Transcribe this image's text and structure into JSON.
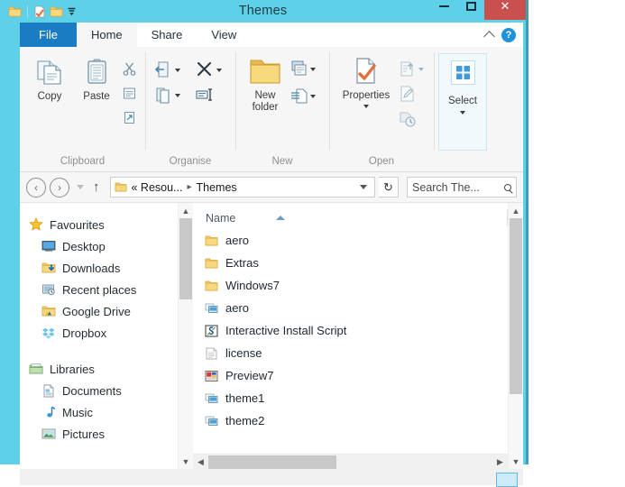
{
  "window": {
    "title": "Themes",
    "controls": {
      "minimize": "minimize-button",
      "maximize": "maximize-button",
      "close": "✕"
    }
  },
  "quick_access": {
    "items": [
      "folder-icon",
      "properties-icon",
      "new-folder-icon",
      "customize-caret"
    ]
  },
  "ribbon": {
    "tabs": [
      {
        "label": "File",
        "active": false,
        "style": "file"
      },
      {
        "label": "Home",
        "active": true
      },
      {
        "label": "Share",
        "active": false
      },
      {
        "label": "View",
        "active": false
      }
    ],
    "collapse_icon": "chevron-up-icon",
    "help_icon": "?",
    "groups": [
      {
        "label": "Clipboard",
        "big_buttons": [
          {
            "label": "Copy",
            "icon": "copy-icon"
          },
          {
            "label": "Paste",
            "icon": "paste-icon"
          }
        ],
        "small_buttons": [
          {
            "name": "cut",
            "icon": "scissors-icon"
          },
          {
            "name": "copy-path",
            "icon": "copy-path-icon"
          },
          {
            "name": "paste-shortcut",
            "icon": "paste-shortcut-icon"
          }
        ]
      },
      {
        "label": "Organise",
        "small_buttons": [
          {
            "name": "move-to",
            "icon": "move-to-icon",
            "caret": true
          },
          {
            "name": "delete",
            "icon": "delete-x-icon",
            "caret": true
          },
          {
            "name": "copy-to",
            "icon": "copy-to-icon",
            "caret": true
          },
          {
            "name": "rename",
            "icon": "rename-icon",
            "caret": false
          }
        ]
      },
      {
        "label": "New",
        "big_buttons": [
          {
            "label": "New\nfolder",
            "line1": "New",
            "line2": "folder",
            "icon": "new-folder-icon"
          }
        ],
        "small_buttons": [
          {
            "name": "new-item",
            "icon": "new-item-icon",
            "caret": true
          },
          {
            "name": "easy-access",
            "icon": "easy-access-icon",
            "caret": true
          }
        ]
      },
      {
        "label": "Open",
        "big_buttons": [
          {
            "label": "Properties",
            "icon": "properties-icon",
            "caret": true
          }
        ],
        "small_buttons": [
          {
            "name": "open",
            "icon": "open-icon",
            "caret": true
          },
          {
            "name": "edit",
            "icon": "edit-icon",
            "caret": false
          },
          {
            "name": "history",
            "icon": "history-icon",
            "caret": false
          }
        ]
      },
      {
        "label": "Select",
        "is_select": true,
        "button": {
          "label": "Select",
          "icon": "select-grid-icon"
        }
      }
    ]
  },
  "address_bar": {
    "back": "‹",
    "forward": "›",
    "recent_caret": "history-dropdown",
    "up": "↑",
    "folder_icon": "folder-icon",
    "crumbs": [
      "« Resou...",
      "Themes"
    ],
    "separator": "▸",
    "dropdown": "address-dropdown",
    "refresh": "↻",
    "search_placeholder": "Search The...",
    "search_value": ""
  },
  "nav_pane": {
    "sections": [
      {
        "root": {
          "label": "Favourites",
          "icon": "star-icon"
        },
        "items": [
          {
            "label": "Desktop",
            "icon": "desktop-icon"
          },
          {
            "label": "Downloads",
            "icon": "downloads-icon"
          },
          {
            "label": "Recent places",
            "icon": "recent-places-icon"
          },
          {
            "label": "Google Drive",
            "icon": "google-drive-icon"
          },
          {
            "label": "Dropbox",
            "icon": "dropbox-icon"
          }
        ]
      },
      {
        "root": {
          "label": "Libraries",
          "icon": "libraries-icon"
        },
        "items": [
          {
            "label": "Documents",
            "icon": "documents-icon"
          },
          {
            "label": "Music",
            "icon": "music-icon"
          },
          {
            "label": "Pictures",
            "icon": "pictures-icon"
          }
        ]
      }
    ]
  },
  "file_list": {
    "column_header": "Name",
    "sort": "ascending",
    "rows": [
      {
        "name": "aero",
        "icon": "folder-icon",
        "type": "folder"
      },
      {
        "name": "Extras",
        "icon": "folder-icon",
        "type": "folder"
      },
      {
        "name": "Windows7",
        "icon": "folder-icon",
        "type": "folder"
      },
      {
        "name": "aero",
        "icon": "theme-icon",
        "type": "theme"
      },
      {
        "name": "Interactive Install Script",
        "icon": "script-icon",
        "type": "script"
      },
      {
        "name": "license",
        "icon": "text-file-icon",
        "type": "text"
      },
      {
        "name": "Preview7",
        "icon": "image-icon",
        "type": "image"
      },
      {
        "name": "theme1",
        "icon": "theme-icon",
        "type": "theme"
      },
      {
        "name": "theme2",
        "icon": "theme-icon",
        "type": "theme"
      }
    ]
  },
  "colors": {
    "titlebar": "#5ed0e8",
    "file_tab": "#1a7cc2",
    "close_button": "#c9504f",
    "ribbon_bg": "#f6f6f6",
    "accent_select": "#cfe6f5"
  }
}
